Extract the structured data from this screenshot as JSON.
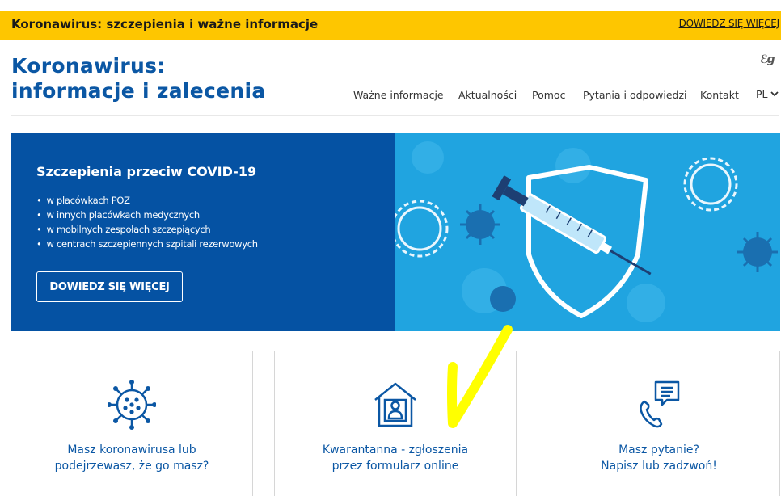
{
  "top_banner": {
    "title": "Koronawirus: szczepienia i ważne informacje",
    "link": "DOWIEDZ SIĘ WIĘCEJ"
  },
  "header": {
    "title_line1": "Koronawirus:",
    "title_line2": "informacje i zalecenia",
    "accessibility_icon": "sign-language-icon"
  },
  "nav": {
    "items": [
      "Ważne informacje",
      "Aktualności",
      "Pomoc",
      "Pytania i odpowiedzi",
      "Kontakt"
    ],
    "language": "PL"
  },
  "hero": {
    "title": "Szczepienia przeciw COVID-19",
    "bullets": [
      "w placówkach POZ",
      "w innych placówkach medycznych",
      "w mobilnych zespołach szczepiących",
      "w centrach szczepiennych szpitali rezerwowych"
    ],
    "button": "DOWIEDZ SIĘ WIĘCEJ",
    "image_icon": "syringe-shield-virus-illustration"
  },
  "cards": [
    {
      "icon": "virus-icon",
      "label": "Masz koronawirusa lub\npodejrzewasz, że go masz?"
    },
    {
      "icon": "house-person-icon",
      "label": "Kwarantanna - zgłoszenia\nprzez formularz online"
    },
    {
      "icon": "phone-chat-icon",
      "label": "Masz pytanie?\nNapisz lub zadzwoń!"
    }
  ],
  "colors": {
    "banner": "#fec600",
    "brand_blue": "#0b57a4",
    "hero_blue": "#0552a3",
    "hero_art_blue": "#20a4e0",
    "annotation_yellow": "#ffff00"
  }
}
